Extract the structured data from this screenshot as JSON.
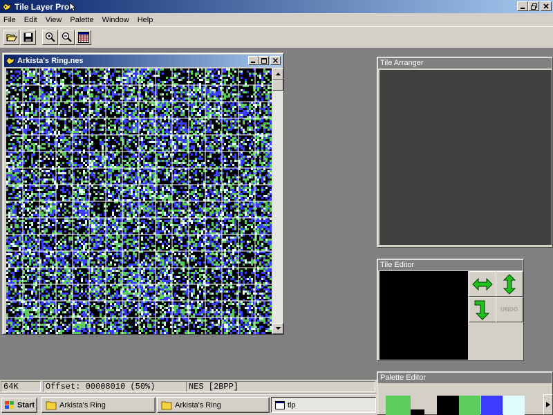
{
  "window": {
    "title": "Tile Layer Pro"
  },
  "menu": [
    "File",
    "Edit",
    "View",
    "Palette",
    "Window",
    "Help"
  ],
  "toolbar": {
    "icons": [
      "open-folder-icon",
      "save-disk-icon",
      "zoom-in-icon",
      "zoom-out-icon",
      "palette-grid-icon"
    ]
  },
  "rom_window": {
    "title": "Arkista's Ring.nes"
  },
  "colors": {
    "nes_palette": [
      "#000000",
      "#5ccc5c",
      "#3c3cff",
      "#e0fcfc"
    ],
    "title_gradient": [
      "#0a246a",
      "#a6caf0"
    ]
  },
  "arranger": {
    "title": "Tile Arranger"
  },
  "tile_editor": {
    "title": "Tile Editor",
    "undo_label": "UNDO"
  },
  "palette_editor": {
    "title": "Palette Editor"
  },
  "status": {
    "size": "64K",
    "offset": "Offset: 00008010 (50%)",
    "format": "NES [2BPP]"
  },
  "taskbar": {
    "start_label": "Start",
    "tasks": [
      "Arkista's Ring",
      "Arkista's Ring",
      "tlp"
    ]
  }
}
